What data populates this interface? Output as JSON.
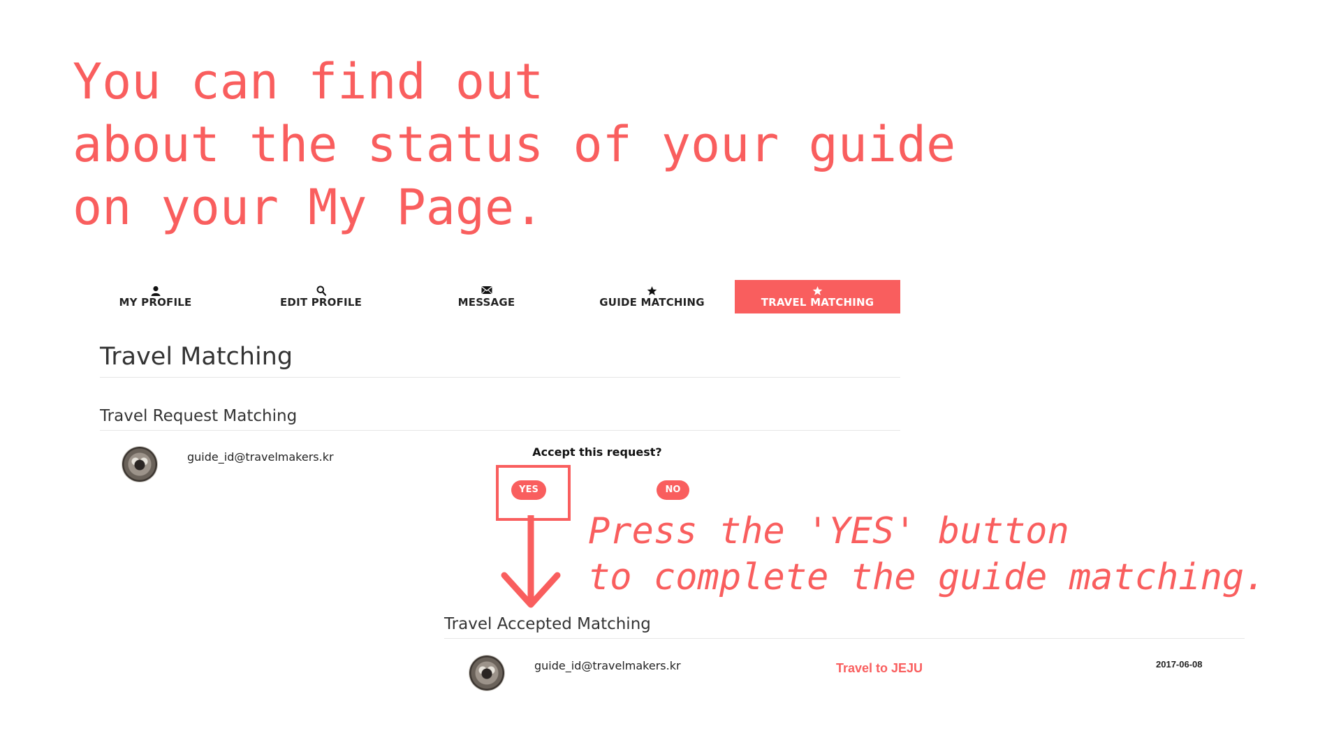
{
  "annotation": {
    "headline_lines": [
      "You can find out",
      "about the status of your guide",
      "on your My Page."
    ],
    "instruction_lines": [
      "Press the 'YES' button",
      "to complete the guide matching."
    ],
    "accent_color": "#f95e5e"
  },
  "nav": {
    "tabs": [
      {
        "label": "MY PROFILE",
        "icon": "user-icon"
      },
      {
        "label": "EDIT PROFILE",
        "icon": "search-icon"
      },
      {
        "label": "MESSAGE",
        "icon": "envelope-icon"
      },
      {
        "label": "GUIDE MATCHING",
        "icon": "star-icon"
      },
      {
        "label": "TRAVEL MATCHING",
        "icon": "star-icon",
        "active": true
      }
    ]
  },
  "page": {
    "title": "Travel Matching"
  },
  "request_section": {
    "title": "Travel Request Matching",
    "email": "guide_id@travelmakers.kr",
    "question": "Accept this request?",
    "yes_label": "YES",
    "no_label": "NO"
  },
  "accepted_section": {
    "title": "Travel Accepted Matching",
    "email": "guide_id@travelmakers.kr",
    "travel": "Travel to JEJU",
    "date": "2017-06-08"
  }
}
